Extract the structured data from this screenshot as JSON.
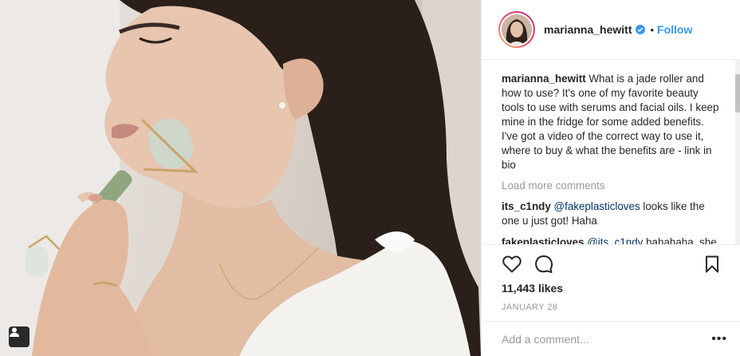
{
  "photo": {
    "alt": "Woman using a jade roller on her face",
    "tag_icon": "user-tag-icon"
  },
  "header": {
    "username": "marianna_hewitt",
    "verified_icon": "verified-badge-icon",
    "separator": "•",
    "follow_label": "Follow",
    "accent_color": "#3897f0"
  },
  "caption": {
    "author": "marianna_hewitt",
    "text": "What is a jade roller and how to use? It's one of my favorite beauty tools to use with serums and facial oils. I keep mine in the fridge for some added benefits. I've got a video of the correct way to use it, where to buy & what the benefits are - link in bio"
  },
  "load_more": "Load more comments",
  "comments": [
    {
      "author": "its_c1ndy",
      "mention": "@fakeplasticloves",
      "text": "looks like the one u just got! Haha"
    },
    {
      "author": "fakeplasticloves",
      "mention": "@its_c1ndy",
      "text": "hahahaha, she"
    }
  ],
  "actions": {
    "like_icon": "heart-icon",
    "comment_icon": "comment-bubble-icon",
    "save_icon": "bookmark-icon"
  },
  "likes": "11,443 likes",
  "date": "JANUARY 28",
  "add_comment": {
    "placeholder": "Add a comment...",
    "more_label": "•••"
  }
}
